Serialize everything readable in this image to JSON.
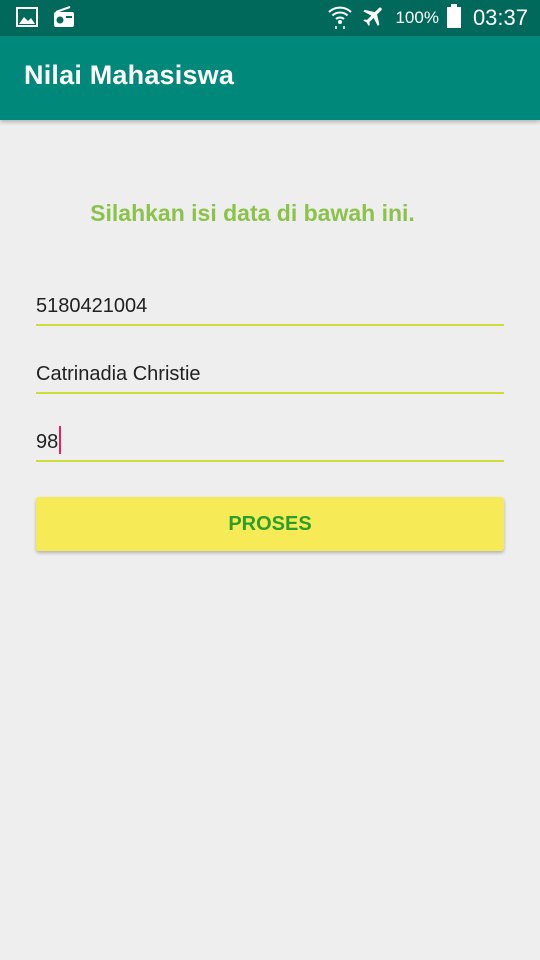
{
  "status_bar": {
    "battery": "100%",
    "time": "03:37",
    "icons": [
      "image-icon",
      "radio-icon",
      "wifi-icon",
      "airplane-mode-icon",
      "battery-icon"
    ]
  },
  "app_bar": {
    "title": "Nilai Mahasiswa",
    "color": "#00897b"
  },
  "form": {
    "instruction": "Silahkan isi data di bawah ini.",
    "nim_value": "5180421004",
    "nama_value": "Catrinadia Christie",
    "nilai_value": "98",
    "submit_label": "PROSES"
  },
  "colors": {
    "status_bar": "#00695c",
    "accent_green": "#8bc34a",
    "underline": "#cddc39",
    "button_bg": "#f7ea57",
    "button_text": "#2e9e2a",
    "cursor": "#e91e63"
  }
}
